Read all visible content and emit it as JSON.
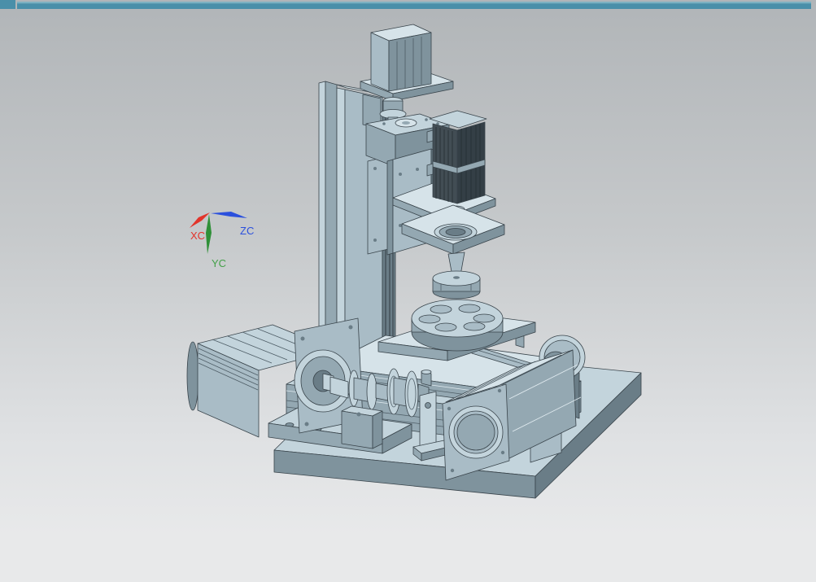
{
  "titlebar": {
    "accent": "#4a8fa9",
    "accent_light": "#7db1c2"
  },
  "viewport": {
    "background_top": "#b1b5b8",
    "background_bottom": "#e8e9ea",
    "triad": {
      "x": {
        "label": "XC",
        "color": "#e2342b"
      },
      "y": {
        "label": "YC",
        "color": "#43a048"
      },
      "z": {
        "label": "ZC",
        "color": "#2b50dd"
      }
    },
    "model": {
      "palette": {
        "light": "#d6e3e9",
        "mid": "#a9bcc6",
        "shade": "#94a8b2",
        "dark": "#6a7d87",
        "outline": "#39444b",
        "motor_body": "#424d54"
      },
      "parts": [
        "column-assembly",
        "z-axis-top-motor",
        "spindle-head",
        "spindle-motor",
        "grinding-wheel",
        "rotary-table",
        "xy-stage",
        "base-plate",
        "a-axis-motor",
        "shaft-coupling-train",
        "bearing-housing",
        "y-axis-motor"
      ]
    }
  }
}
